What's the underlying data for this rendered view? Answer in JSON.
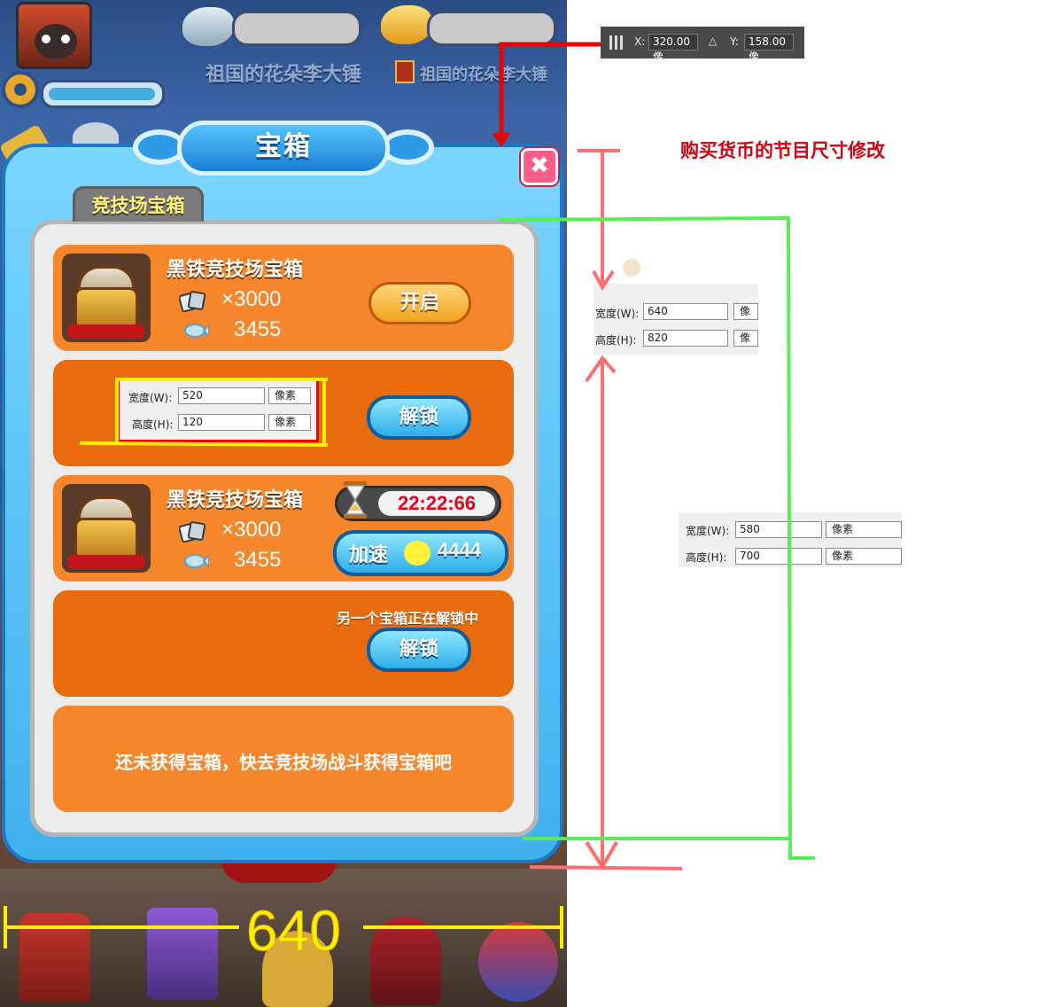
{
  "game": {
    "player_names": [
      "祖国的花朵李大锤",
      "祖国的花朵李大锤"
    ],
    "dialog_title": "宝箱",
    "close_symbol": "✖",
    "tab_label": "竞技场宝箱",
    "slots": [
      {
        "name": "黑铁竞技场宝箱",
        "card_qty": "×3000",
        "gem_qty": "3455",
        "button": "开启"
      },
      {
        "button": "解锁"
      },
      {
        "name": "黑铁竞技场宝箱",
        "card_qty": "×3000",
        "gem_qty": "3455",
        "timer": "22:22:66",
        "speed_label": "加速",
        "speed_cost": "4444"
      },
      {
        "notice": "另一个宝箱正在解锁中",
        "button": "解锁"
      },
      {
        "empty_text": "还未获得宝箱，快去竞技场战斗获得宝箱吧"
      }
    ]
  },
  "annotations": {
    "red_note": "购买货币的节目尺寸修改",
    "bottom_width_label": "640",
    "ps_position": {
      "x_label": "X:",
      "x_value": "320.00 像",
      "y_label": "Y:",
      "y_value": "158.00 像"
    },
    "ps_size_slot": {
      "w_label": "宽度(W):",
      "w_value": "520",
      "h_label": "高度(H):",
      "h_value": "120",
      "unit": "像素"
    },
    "ps_size_dialog": {
      "w_label": "宽度(W):",
      "w_value": "640",
      "h_label": "高度(H):",
      "h_value": "820",
      "unit": "像素"
    },
    "ps_size_inner": {
      "w_label": "宽度(W):",
      "w_value": "580",
      "h_label": "高度(H):",
      "h_value": "700",
      "unit": "像素"
    }
  },
  "colors": {
    "red_note": "#d6000f",
    "green_line": "#55ee55",
    "red_line": "#ff6e6e",
    "yellow_line": "#ffee00"
  }
}
